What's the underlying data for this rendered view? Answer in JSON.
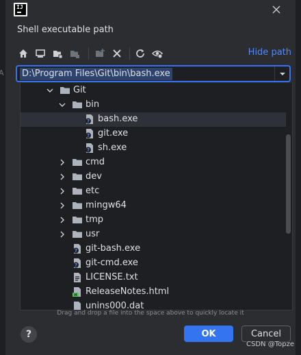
{
  "background": {
    "ghost_text": "A"
  },
  "dialog": {
    "title": "Shell executable path",
    "hide_path_label": "Hide path",
    "path_value": "D:\\Program Files\\Git\\bin\\bash.exe",
    "hint": "Drag and drop a file into the space above to quickly locate it",
    "ok_label": "OK",
    "cancel_label": "Cancel",
    "help_label": "?"
  },
  "toolbar": {
    "icons": [
      "home-icon",
      "desktop-icon",
      "project-folder-icon",
      "module-folder-icon",
      "new-folder-icon",
      "delete-icon",
      "refresh-icon",
      "show-hidden-icon"
    ]
  },
  "tree": {
    "rows": [
      {
        "label": "Git",
        "type": "folder",
        "expanded": true
      },
      {
        "label": "bin",
        "type": "folder",
        "expanded": true
      },
      {
        "label": "bash.exe",
        "type": "exe",
        "selected": true
      },
      {
        "label": "git.exe",
        "type": "exe"
      },
      {
        "label": "sh.exe",
        "type": "exe"
      },
      {
        "label": "cmd",
        "type": "folder",
        "expanded": false
      },
      {
        "label": "dev",
        "type": "folder",
        "expanded": false
      },
      {
        "label": "etc",
        "type": "folder",
        "expanded": false
      },
      {
        "label": "mingw64",
        "type": "folder",
        "expanded": false
      },
      {
        "label": "tmp",
        "type": "folder",
        "expanded": false
      },
      {
        "label": "usr",
        "type": "folder",
        "expanded": false
      },
      {
        "label": "git-bash.exe",
        "type": "exe"
      },
      {
        "label": "git-cmd.exe",
        "type": "exe"
      },
      {
        "label": "LICENSE.txt",
        "type": "text"
      },
      {
        "label": "ReleaseNotes.html",
        "type": "html"
      },
      {
        "label": "unins000.dat",
        "type": "file"
      }
    ]
  },
  "watermark": "CSDN @Topze",
  "colors": {
    "accent": "#3574f0",
    "link": "#548af7",
    "background": "#2b2d30",
    "tree_bg": "#1e1f22",
    "selection": "#2e3137"
  }
}
